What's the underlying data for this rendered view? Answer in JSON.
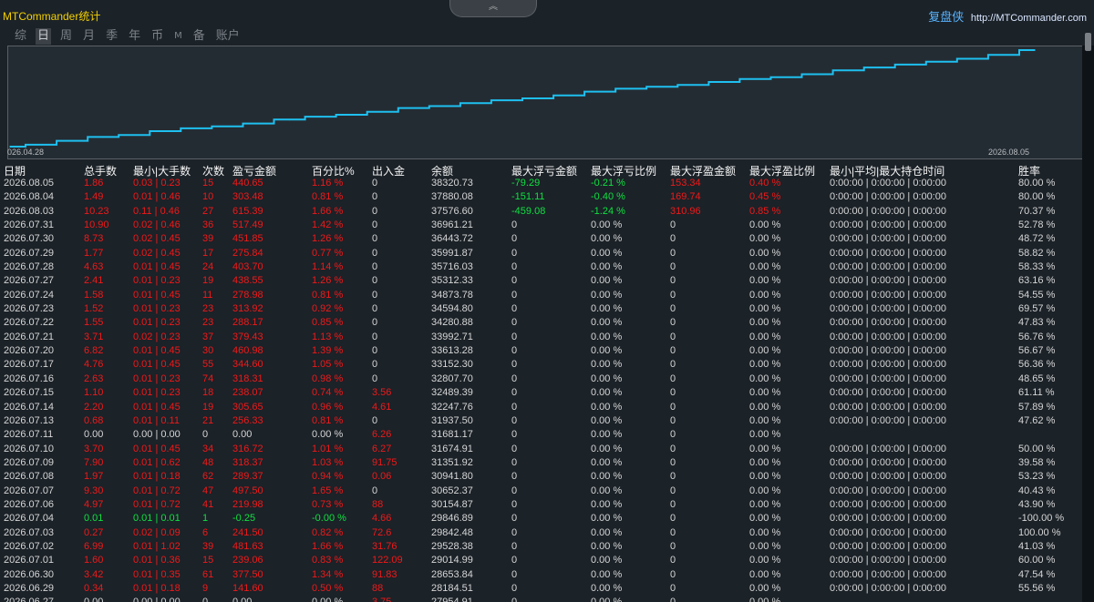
{
  "app_title": "MTCommander统计",
  "brand": {
    "name": "复盘侠",
    "url": "http://MTCommander.com"
  },
  "collapse_icon": "chevron-up-icon",
  "tabs": [
    {
      "label": "综",
      "active": false
    },
    {
      "label": "日",
      "active": true
    },
    {
      "label": "周",
      "active": false
    },
    {
      "label": "月",
      "active": false
    },
    {
      "label": "季",
      "active": false
    },
    {
      "label": "年",
      "active": false
    },
    {
      "label": "币",
      "active": false
    },
    {
      "label": "M",
      "active": false
    },
    {
      "label": "备",
      "active": false
    },
    {
      "label": "账户",
      "active": false
    }
  ],
  "chart_data": {
    "type": "line",
    "x_start_label": "026.04.28",
    "x_end_label": "2026.08.05",
    "line_color": "#1ec0f0",
    "grid": false,
    "values": [
      0,
      2,
      6,
      10,
      12,
      16,
      19,
      21,
      24,
      28,
      31,
      33,
      36,
      40,
      42,
      45,
      48,
      50,
      53,
      57,
      60,
      62,
      64,
      67,
      70,
      72,
      75,
      79,
      82,
      85,
      88,
      91,
      95,
      100
    ]
  },
  "colors": {
    "loss": "#f21818",
    "gain": "#10e040",
    "neutral": "#d6d6d6"
  },
  "columns": {
    "date": "日期",
    "lots": "总手数",
    "minmax": "最小|大手数",
    "count": "次数",
    "profit": "盈亏金额",
    "pct": "百分比%",
    "io": "出入金",
    "balance": "余额",
    "max_loss_value": "最大浮亏金额",
    "max_loss_pct": "最大浮亏比例",
    "max_profit_value": "最大浮盈金额",
    "max_profit_pct": "最大浮盈比例",
    "hold_time": "最小|平均|最大持仓时间",
    "winrate": "胜率"
  },
  "rows": [
    {
      "date": "2026.08.05",
      "lots": "1.86",
      "minmax": "0.03 | 0.23",
      "count": "15",
      "profit": "440.65",
      "pct": "1.16 %",
      "io": "0",
      "balance": "38320.73",
      "mlv": "-79.29",
      "mlp": "-0.21 %",
      "mpv": "153.34",
      "mpp": "0.40 %",
      "time": "0:00:00 | 0:00:00 | 0:00:00",
      "win": "80.00 %",
      "color": "red"
    },
    {
      "date": "2026.08.04",
      "lots": "1.49",
      "minmax": "0.01 | 0.46",
      "count": "10",
      "profit": "303.48",
      "pct": "0.81 %",
      "io": "0",
      "balance": "37880.08",
      "mlv": "-151.11",
      "mlp": "-0.40 %",
      "mpv": "169.74",
      "mpp": "0.45 %",
      "time": "0:00:00 | 0:00:00 | 0:00:00",
      "win": "80.00 %",
      "color": "red"
    },
    {
      "date": "2026.08.03",
      "lots": "10.23",
      "minmax": "0.11 | 0.46",
      "count": "27",
      "profit": "615.39",
      "pct": "1.66 %",
      "io": "0",
      "balance": "37576.60",
      "mlv": "-459.08",
      "mlp": "-1.24 %",
      "mpv": "310.96",
      "mpp": "0.85 %",
      "time": "0:00:00 | 0:00:00 | 0:00:00",
      "win": "70.37 %",
      "color": "red"
    },
    {
      "date": "2026.07.31",
      "lots": "10.90",
      "minmax": "0.02 | 0.46",
      "count": "36",
      "profit": "517.49",
      "pct": "1.42 %",
      "io": "0",
      "balance": "36961.21",
      "mlv": "0",
      "mlp": "0.00 %",
      "mpv": "0",
      "mpp": "0.00 %",
      "time": "0:00:00 | 0:00:00 | 0:00:00",
      "win": "52.78 %",
      "color": "red"
    },
    {
      "date": "2026.07.30",
      "lots": "8.73",
      "minmax": "0.02 | 0.45",
      "count": "39",
      "profit": "451.85",
      "pct": "1.26 %",
      "io": "0",
      "balance": "36443.72",
      "mlv": "0",
      "mlp": "0.00 %",
      "mpv": "0",
      "mpp": "0.00 %",
      "time": "0:00:00 | 0:00:00 | 0:00:00",
      "win": "48.72 %",
      "color": "red"
    },
    {
      "date": "2026.07.29",
      "lots": "1.77",
      "minmax": "0.02 | 0.45",
      "count": "17",
      "profit": "275.84",
      "pct": "0.77 %",
      "io": "0",
      "balance": "35991.87",
      "mlv": "0",
      "mlp": "0.00 %",
      "mpv": "0",
      "mpp": "0.00 %",
      "time": "0:00:00 | 0:00:00 | 0:00:00",
      "win": "58.82 %",
      "color": "red"
    },
    {
      "date": "2026.07.28",
      "lots": "4.63",
      "minmax": "0.01 | 0.45",
      "count": "24",
      "profit": "403.70",
      "pct": "1.14 %",
      "io": "0",
      "balance": "35716.03",
      "mlv": "0",
      "mlp": "0.00 %",
      "mpv": "0",
      "mpp": "0.00 %",
      "time": "0:00:00 | 0:00:00 | 0:00:00",
      "win": "58.33 %",
      "color": "red"
    },
    {
      "date": "2026.07.27",
      "lots": "2.41",
      "minmax": "0.01 | 0.23",
      "count": "19",
      "profit": "438.55",
      "pct": "1.26 %",
      "io": "0",
      "balance": "35312.33",
      "mlv": "0",
      "mlp": "0.00 %",
      "mpv": "0",
      "mpp": "0.00 %",
      "time": "0:00:00 | 0:00:00 | 0:00:00",
      "win": "63.16 %",
      "color": "red"
    },
    {
      "date": "2026.07.24",
      "lots": "1.58",
      "minmax": "0.01 | 0.45",
      "count": "11",
      "profit": "278.98",
      "pct": "0.81 %",
      "io": "0",
      "balance": "34873.78",
      "mlv": "0",
      "mlp": "0.00 %",
      "mpv": "0",
      "mpp": "0.00 %",
      "time": "0:00:00 | 0:00:00 | 0:00:00",
      "win": "54.55 %",
      "color": "red"
    },
    {
      "date": "2026.07.23",
      "lots": "1.52",
      "minmax": "0.01 | 0.23",
      "count": "23",
      "profit": "313.92",
      "pct": "0.92 %",
      "io": "0",
      "balance": "34594.80",
      "mlv": "0",
      "mlp": "0.00 %",
      "mpv": "0",
      "mpp": "0.00 %",
      "time": "0:00:00 | 0:00:00 | 0:00:00",
      "win": "69.57 %",
      "color": "red"
    },
    {
      "date": "2026.07.22",
      "lots": "1.55",
      "minmax": "0.01 | 0.23",
      "count": "23",
      "profit": "288.17",
      "pct": "0.85 %",
      "io": "0",
      "balance": "34280.88",
      "mlv": "0",
      "mlp": "0.00 %",
      "mpv": "0",
      "mpp": "0.00 %",
      "time": "0:00:00 | 0:00:00 | 0:00:00",
      "win": "47.83 %",
      "color": "red"
    },
    {
      "date": "2026.07.21",
      "lots": "3.71",
      "minmax": "0.02 | 0.23",
      "count": "37",
      "profit": "379.43",
      "pct": "1.13 %",
      "io": "0",
      "balance": "33992.71",
      "mlv": "0",
      "mlp": "0.00 %",
      "mpv": "0",
      "mpp": "0.00 %",
      "time": "0:00:00 | 0:00:00 | 0:00:00",
      "win": "56.76 %",
      "color": "red"
    },
    {
      "date": "2026.07.20",
      "lots": "6.82",
      "minmax": "0.01 | 0.45",
      "count": "30",
      "profit": "460.98",
      "pct": "1.39 %",
      "io": "0",
      "balance": "33613.28",
      "mlv": "0",
      "mlp": "0.00 %",
      "mpv": "0",
      "mpp": "0.00 %",
      "time": "0:00:00 | 0:00:00 | 0:00:00",
      "win": "56.67 %",
      "color": "red"
    },
    {
      "date": "2026.07.17",
      "lots": "4.76",
      "minmax": "0.01 | 0.45",
      "count": "55",
      "profit": "344.60",
      "pct": "1.05 %",
      "io": "0",
      "balance": "33152.30",
      "mlv": "0",
      "mlp": "0.00 %",
      "mpv": "0",
      "mpp": "0.00 %",
      "time": "0:00:00 | 0:00:00 | 0:00:00",
      "win": "56.36 %",
      "color": "red"
    },
    {
      "date": "2026.07.16",
      "lots": "2.63",
      "minmax": "0.01 | 0.23",
      "count": "74",
      "profit": "318.31",
      "pct": "0.98 %",
      "io": "0",
      "balance": "32807.70",
      "mlv": "0",
      "mlp": "0.00 %",
      "mpv": "0",
      "mpp": "0.00 %",
      "time": "0:00:00 | 0:00:00 | 0:00:00",
      "win": "48.65 %",
      "color": "red"
    },
    {
      "date": "2026.07.15",
      "lots": "1.10",
      "minmax": "0.01 | 0.23",
      "count": "18",
      "profit": "238.07",
      "pct": "0.74 %",
      "io": "3.56",
      "balance": "32489.39",
      "mlv": "0",
      "mlp": "0.00 %",
      "mpv": "0",
      "mpp": "0.00 %",
      "time": "0:00:00 | 0:00:00 | 0:00:00",
      "win": "61.11 %",
      "color": "red"
    },
    {
      "date": "2026.07.14",
      "lots": "2.20",
      "minmax": "0.01 | 0.45",
      "count": "19",
      "profit": "305.65",
      "pct": "0.96 %",
      "io": "4.61",
      "balance": "32247.76",
      "mlv": "0",
      "mlp": "0.00 %",
      "mpv": "0",
      "mpp": "0.00 %",
      "time": "0:00:00 | 0:00:00 | 0:00:00",
      "win": "57.89 %",
      "color": "red"
    },
    {
      "date": "2026.07.13",
      "lots": "0.68",
      "minmax": "0.01 | 0.11",
      "count": "21",
      "profit": "256.33",
      "pct": "0.81 %",
      "io": "0",
      "balance": "31937.50",
      "mlv": "0",
      "mlp": "0.00 %",
      "mpv": "0",
      "mpp": "0.00 %",
      "time": "0:00:00 | 0:00:00 | 0:00:00",
      "win": "47.62 %",
      "color": "red"
    },
    {
      "date": "2026.07.11",
      "lots": "0.00",
      "minmax": "0.00 | 0.00",
      "count": "0",
      "profit": "0.00",
      "pct": "0.00 %",
      "io": "6.26",
      "balance": "31681.17",
      "mlv": "0",
      "mlp": "0.00 %",
      "mpv": "0",
      "mpp": "0.00 %",
      "time": "",
      "win": "",
      "color": "white"
    },
    {
      "date": "2026.07.10",
      "lots": "3.70",
      "minmax": "0.01 | 0.45",
      "count": "34",
      "profit": "316.72",
      "pct": "1.01 %",
      "io": "6.27",
      "balance": "31674.91",
      "mlv": "0",
      "mlp": "0.00 %",
      "mpv": "0",
      "mpp": "0.00 %",
      "time": "0:00:00 | 0:00:00 | 0:00:00",
      "win": "50.00 %",
      "color": "red"
    },
    {
      "date": "2026.07.09",
      "lots": "7.90",
      "minmax": "0.01 | 0.62",
      "count": "48",
      "profit": "318.37",
      "pct": "1.03 %",
      "io": "91.75",
      "balance": "31351.92",
      "mlv": "0",
      "mlp": "0.00 %",
      "mpv": "0",
      "mpp": "0.00 %",
      "time": "0:00:00 | 0:00:00 | 0:00:00",
      "win": "39.58 %",
      "color": "red"
    },
    {
      "date": "2026.07.08",
      "lots": "1.97",
      "minmax": "0.01 | 0.18",
      "count": "62",
      "profit": "289.37",
      "pct": "0.94 %",
      "io": "0.06",
      "balance": "30941.80",
      "mlv": "0",
      "mlp": "0.00 %",
      "mpv": "0",
      "mpp": "0.00 %",
      "time": "0:00:00 | 0:00:00 | 0:00:00",
      "win": "53.23 %",
      "color": "red"
    },
    {
      "date": "2026.07.07",
      "lots": "9.30",
      "minmax": "0.01 | 0.72",
      "count": "47",
      "profit": "497.50",
      "pct": "1.65 %",
      "io": "0",
      "balance": "30652.37",
      "mlv": "0",
      "mlp": "0.00 %",
      "mpv": "0",
      "mpp": "0.00 %",
      "time": "0:00:00 | 0:00:00 | 0:00:00",
      "win": "40.43 %",
      "color": "red"
    },
    {
      "date": "2026.07.06",
      "lots": "4.97",
      "minmax": "0.01 | 0.72",
      "count": "41",
      "profit": "219.98",
      "pct": "0.73 %",
      "io": "88",
      "balance": "30154.87",
      "mlv": "0",
      "mlp": "0.00 %",
      "mpv": "0",
      "mpp": "0.00 %",
      "time": "0:00:00 | 0:00:00 | 0:00:00",
      "win": "43.90 %",
      "color": "red"
    },
    {
      "date": "2026.07.04",
      "lots": "0.01",
      "minmax": "0.01 | 0.01",
      "count": "1",
      "profit": "-0.25",
      "pct": "-0.00 %",
      "io": "4.66",
      "balance": "29846.89",
      "mlv": "0",
      "mlp": "0.00 %",
      "mpv": "0",
      "mpp": "0.00 %",
      "time": "0:00:00 | 0:00:00 | 0:00:00",
      "win": "-100.00 %",
      "color": "green"
    },
    {
      "date": "2026.07.03",
      "lots": "0.27",
      "minmax": "0.02 | 0.09",
      "count": "6",
      "profit": "241.50",
      "pct": "0.82 %",
      "io": "72.6",
      "balance": "29842.48",
      "mlv": "0",
      "mlp": "0.00 %",
      "mpv": "0",
      "mpp": "0.00 %",
      "time": "0:00:00 | 0:00:00 | 0:00:00",
      "win": "100.00 %",
      "color": "red"
    },
    {
      "date": "2026.07.02",
      "lots": "6.99",
      "minmax": "0.01 | 1.02",
      "count": "39",
      "profit": "481.63",
      "pct": "1.66 %",
      "io": "31.76",
      "balance": "29528.38",
      "mlv": "0",
      "mlp": "0.00 %",
      "mpv": "0",
      "mpp": "0.00 %",
      "time": "0:00:00 | 0:00:00 | 0:00:00",
      "win": "41.03 %",
      "color": "red"
    },
    {
      "date": "2026.07.01",
      "lots": "1.60",
      "minmax": "0.01 | 0.36",
      "count": "15",
      "profit": "239.06",
      "pct": "0.83 %",
      "io": "122.09",
      "balance": "29014.99",
      "mlv": "0",
      "mlp": "0.00 %",
      "mpv": "0",
      "mpp": "0.00 %",
      "time": "0:00:00 | 0:00:00 | 0:00:00",
      "win": "60.00 %",
      "color": "red"
    },
    {
      "date": "2026.06.30",
      "lots": "3.42",
      "minmax": "0.01 | 0.35",
      "count": "61",
      "profit": "377.50",
      "pct": "1.34 %",
      "io": "91.83",
      "balance": "28653.84",
      "mlv": "0",
      "mlp": "0.00 %",
      "mpv": "0",
      "mpp": "0.00 %",
      "time": "0:00:00 | 0:00:00 | 0:00:00",
      "win": "47.54 %",
      "color": "red"
    },
    {
      "date": "2026.06.29",
      "lots": "0.34",
      "minmax": "0.01 | 0.18",
      "count": "9",
      "profit": "141.60",
      "pct": "0.50 %",
      "io": "88",
      "balance": "28184.51",
      "mlv": "0",
      "mlp": "0.00 %",
      "mpv": "0",
      "mpp": "0.00 %",
      "time": "0:00:00 | 0:00:00 | 0:00:00",
      "win": "55.56 %",
      "color": "red"
    },
    {
      "date": "2026.06.27",
      "lots": "0.00",
      "minmax": "0.00 | 0.00",
      "count": "0",
      "profit": "0.00",
      "pct": "0.00 %",
      "io": "3.75",
      "balance": "27954.91",
      "mlv": "0",
      "mlp": "0.00 %",
      "mpv": "0",
      "mpp": "0.00 %",
      "time": "",
      "win": "",
      "color": "white"
    }
  ]
}
